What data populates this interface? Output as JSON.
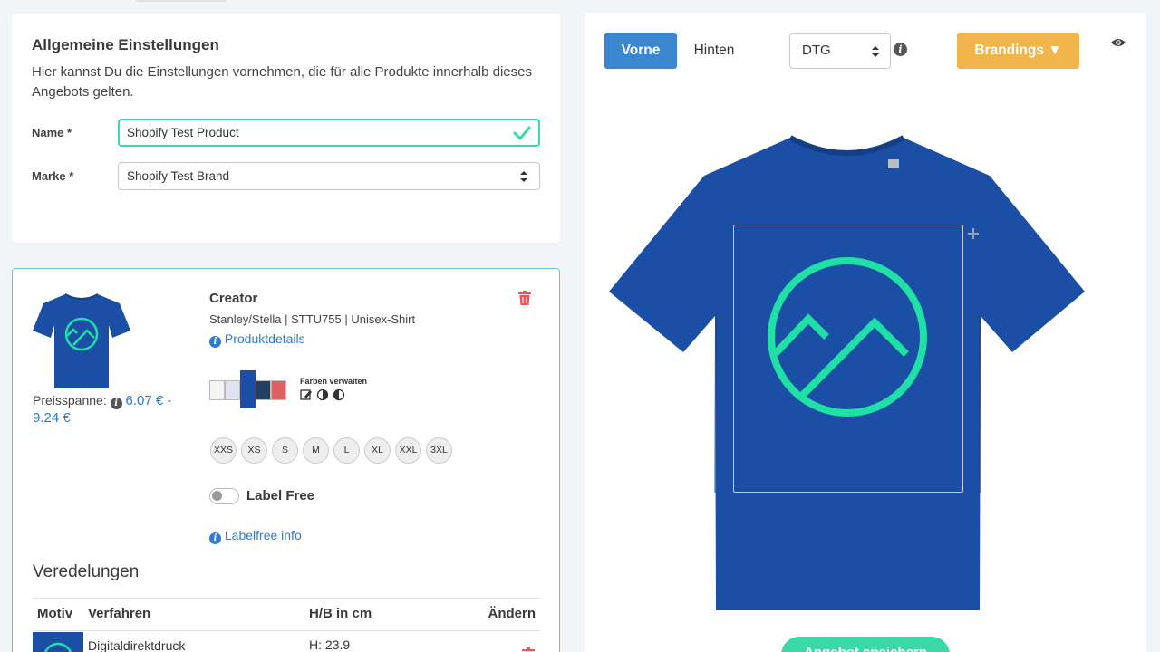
{
  "settings": {
    "title": "Allgemeine Einstellungen",
    "description": "Hier kannst Du die Einstellungen vornehmen, die für alle Produkte innerhalb dieses Angebots gelten.",
    "name_label": "Name *",
    "name_value": "Shopify Test Product",
    "brand_label": "Marke *",
    "brand_value": "Shopify Test Brand"
  },
  "product": {
    "name": "Creator",
    "meta": "Stanley/Stella | STTU755 | Unisex-Shirt",
    "details_link": "Produktdetails",
    "price_label": "Preisspanne:",
    "price_range": "6.07 € - 9.24 €",
    "colors_label": "Farben verwalten",
    "sizes": [
      "XXS",
      "XS",
      "S",
      "M",
      "L",
      "XL",
      "XXL",
      "3XL"
    ],
    "label_free_toggle": "Label Free",
    "label_free_on": false,
    "labelfree_link": "Labelfree info",
    "swatch_colors": [
      "#f4f4f4",
      "#e7e9f1",
      "#c9d6e8",
      "#1b4fa6",
      "#1e3e6e",
      "#2e4a5c",
      "#e0605f"
    ]
  },
  "veredelungen": {
    "title": "Veredelungen",
    "columns": [
      "Motiv",
      "Verfahren",
      "H/B in cm",
      "Ändern"
    ],
    "rows": [
      {
        "verfahren": "Digitaldirektdruck",
        "size": "H: 23.9"
      }
    ]
  },
  "preview": {
    "tabs": [
      "Vorne",
      "Hinten"
    ],
    "active_tab": "Vorne",
    "method": "DTG",
    "brandings_label": "Brandings ▼",
    "save_label": "Angebot speichern"
  },
  "colors": {
    "primary": "#3b86d1",
    "accent_green": "#3bd9a8",
    "accent_orange": "#f2b54b",
    "shirt_blue": "#1b4fa6",
    "logo_green": "#1fe0a5",
    "link_blue": "#2f7bd0",
    "danger": "#e8555a"
  }
}
